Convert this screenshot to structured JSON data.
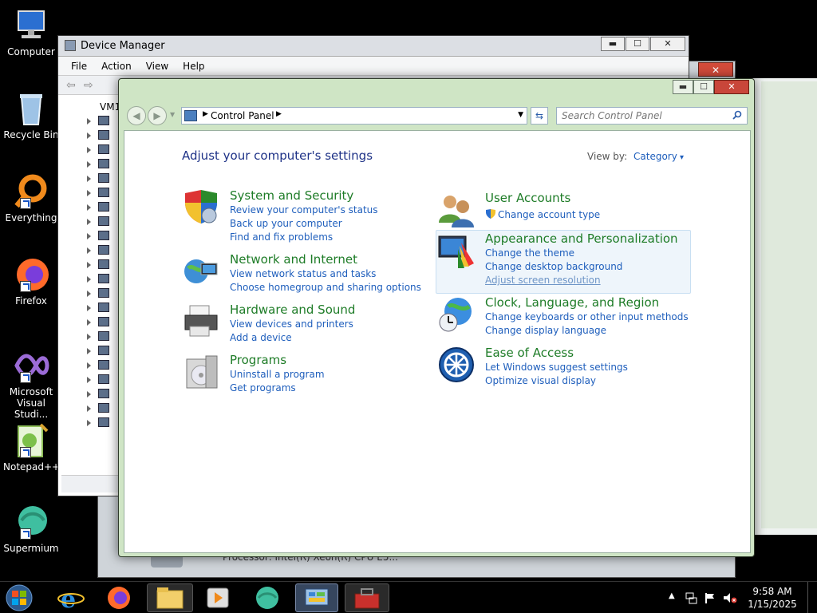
{
  "desktop": {
    "icons": [
      {
        "label": "Computer"
      },
      {
        "label": "Recycle Bin"
      },
      {
        "label": "Everything"
      },
      {
        "label": "Firefox"
      },
      {
        "label": "Microsoft Visual Studi..."
      },
      {
        "label": "Notepad++"
      },
      {
        "label": "Supermium"
      }
    ]
  },
  "system_info_window": {
    "processor_text": "Processor:  Intel(R) Xeon(R) CPU E5..."
  },
  "device_manager": {
    "title": "Device Manager",
    "menu": [
      "File",
      "Action",
      "View",
      "Help"
    ],
    "tree_root": "VM1"
  },
  "control_panel": {
    "address_segment": "Control Panel",
    "search_placeholder": "Search Control Panel",
    "heading": "Adjust your computer's settings",
    "view_by_label": "View by:",
    "view_by_value": "Category",
    "categories": [
      {
        "title": "System and Security",
        "links": [
          "Review your computer's status",
          "Back up your computer",
          "Find and fix problems"
        ]
      },
      {
        "title": "Network and Internet",
        "links": [
          "View network status and tasks",
          "Choose homegroup and sharing options"
        ]
      },
      {
        "title": "Hardware and Sound",
        "links": [
          "View devices and printers",
          "Add a device"
        ]
      },
      {
        "title": "Programs",
        "links": [
          "Uninstall a program",
          "Get programs"
        ]
      },
      {
        "title": "User Accounts",
        "links": [
          "Change account type"
        ]
      },
      {
        "title": "Appearance and Personalization",
        "links": [
          "Change the theme",
          "Change desktop background",
          "Adjust screen resolution"
        ]
      },
      {
        "title": "Clock, Language, and Region",
        "links": [
          "Change keyboards or other input methods",
          "Change display language"
        ]
      },
      {
        "title": "Ease of Access",
        "links": [
          "Let Windows suggest settings",
          "Optimize visual display"
        ]
      }
    ]
  },
  "taskbar": {
    "time": "9:58 AM",
    "date": "1/15/2025"
  }
}
